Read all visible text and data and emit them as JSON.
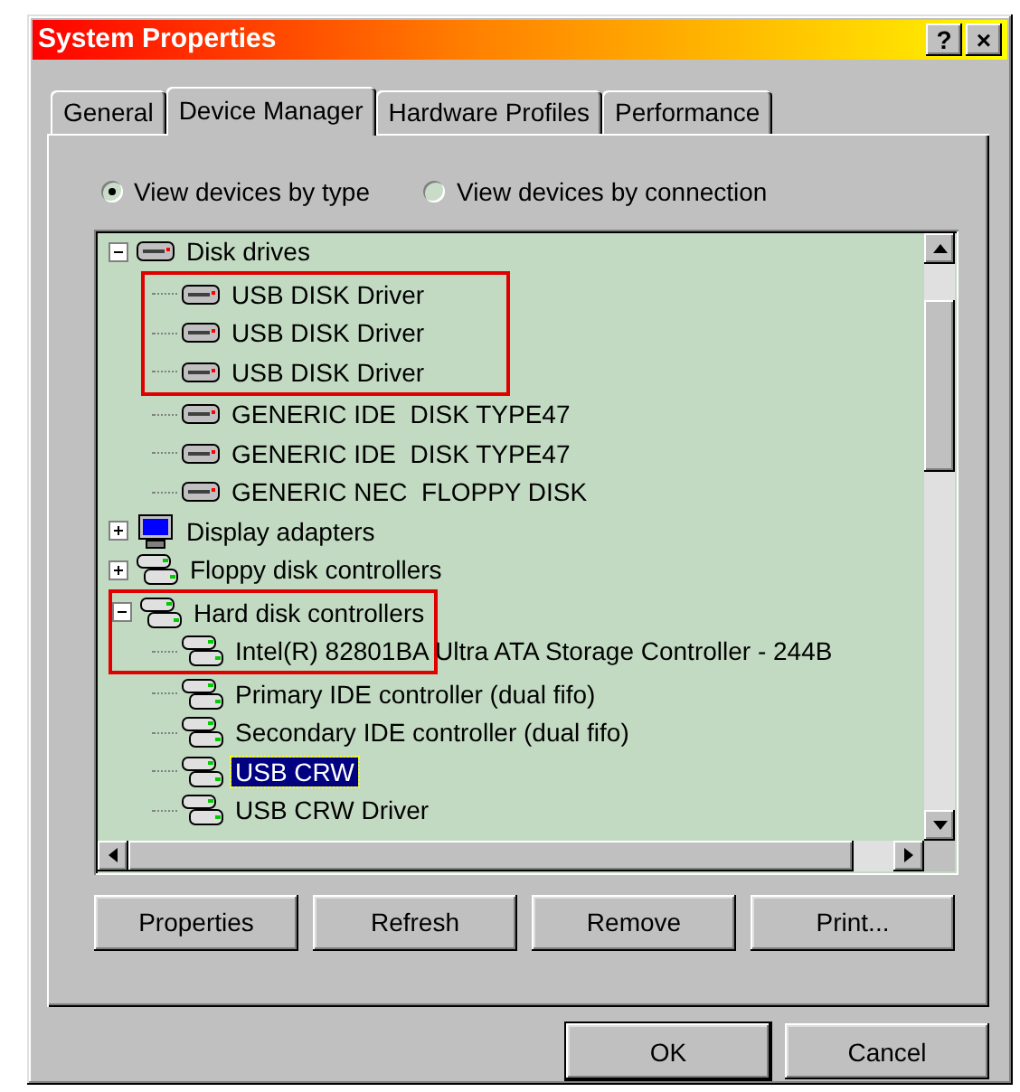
{
  "window": {
    "title": "System Properties",
    "help_button": "?",
    "close_button": "×"
  },
  "tabs": [
    {
      "label": "General",
      "selected": false
    },
    {
      "label": "Device Manager",
      "selected": true
    },
    {
      "label": "Hardware Profiles",
      "selected": false
    },
    {
      "label": "Performance",
      "selected": false
    }
  ],
  "view_options": [
    {
      "label": "View devices by type",
      "selected": true
    },
    {
      "label": "View devices by connection",
      "selected": false
    }
  ],
  "tree": [
    {
      "label": "Disk drives",
      "kind": "disk",
      "expanded": true,
      "selected": false,
      "highlighted": false,
      "children": [
        {
          "label": "USB DISK Driver",
          "kind": "disk",
          "selected": false,
          "highlighted": true
        },
        {
          "label": "USB DISK Driver",
          "kind": "disk",
          "selected": false,
          "highlighted": true
        },
        {
          "label": "USB DISK Driver",
          "kind": "disk",
          "selected": false,
          "highlighted": true
        },
        {
          "label": "GENERIC IDE  DISK TYPE47",
          "kind": "disk",
          "selected": false,
          "highlighted": false
        },
        {
          "label": "GENERIC IDE  DISK TYPE47",
          "kind": "disk",
          "selected": false,
          "highlighted": false
        },
        {
          "label": "GENERIC NEC  FLOPPY DISK",
          "kind": "disk",
          "selected": false,
          "highlighted": false
        }
      ]
    },
    {
      "label": "Display adapters",
      "kind": "monitor",
      "expanded": false,
      "selected": false,
      "highlighted": false
    },
    {
      "label": "Floppy disk controllers",
      "kind": "controller",
      "expanded": false,
      "selected": false,
      "highlighted": false
    },
    {
      "label": "Hard disk controllers",
      "kind": "controller",
      "expanded": true,
      "selected": false,
      "highlighted": true,
      "children": [
        {
          "label": "Intel(R) 82801BA Ultra ATA Storage Controller - 244B",
          "kind": "controller",
          "selected": false,
          "highlighted": true
        },
        {
          "label": "Primary IDE controller (dual fifo)",
          "kind": "controller",
          "selected": false,
          "highlighted": false
        },
        {
          "label": "Secondary IDE controller (dual fifo)",
          "kind": "controller",
          "selected": false,
          "highlighted": false
        },
        {
          "label": "USB CRW",
          "kind": "controller",
          "selected": true,
          "highlighted": false
        },
        {
          "label": "USB CRW Driver",
          "kind": "controller",
          "selected": false,
          "highlighted": false
        }
      ]
    }
  ],
  "buttons": [
    "Properties",
    "Refresh",
    "Remove",
    "Print..."
  ],
  "dialog_buttons": [
    "OK",
    "Cancel"
  ]
}
